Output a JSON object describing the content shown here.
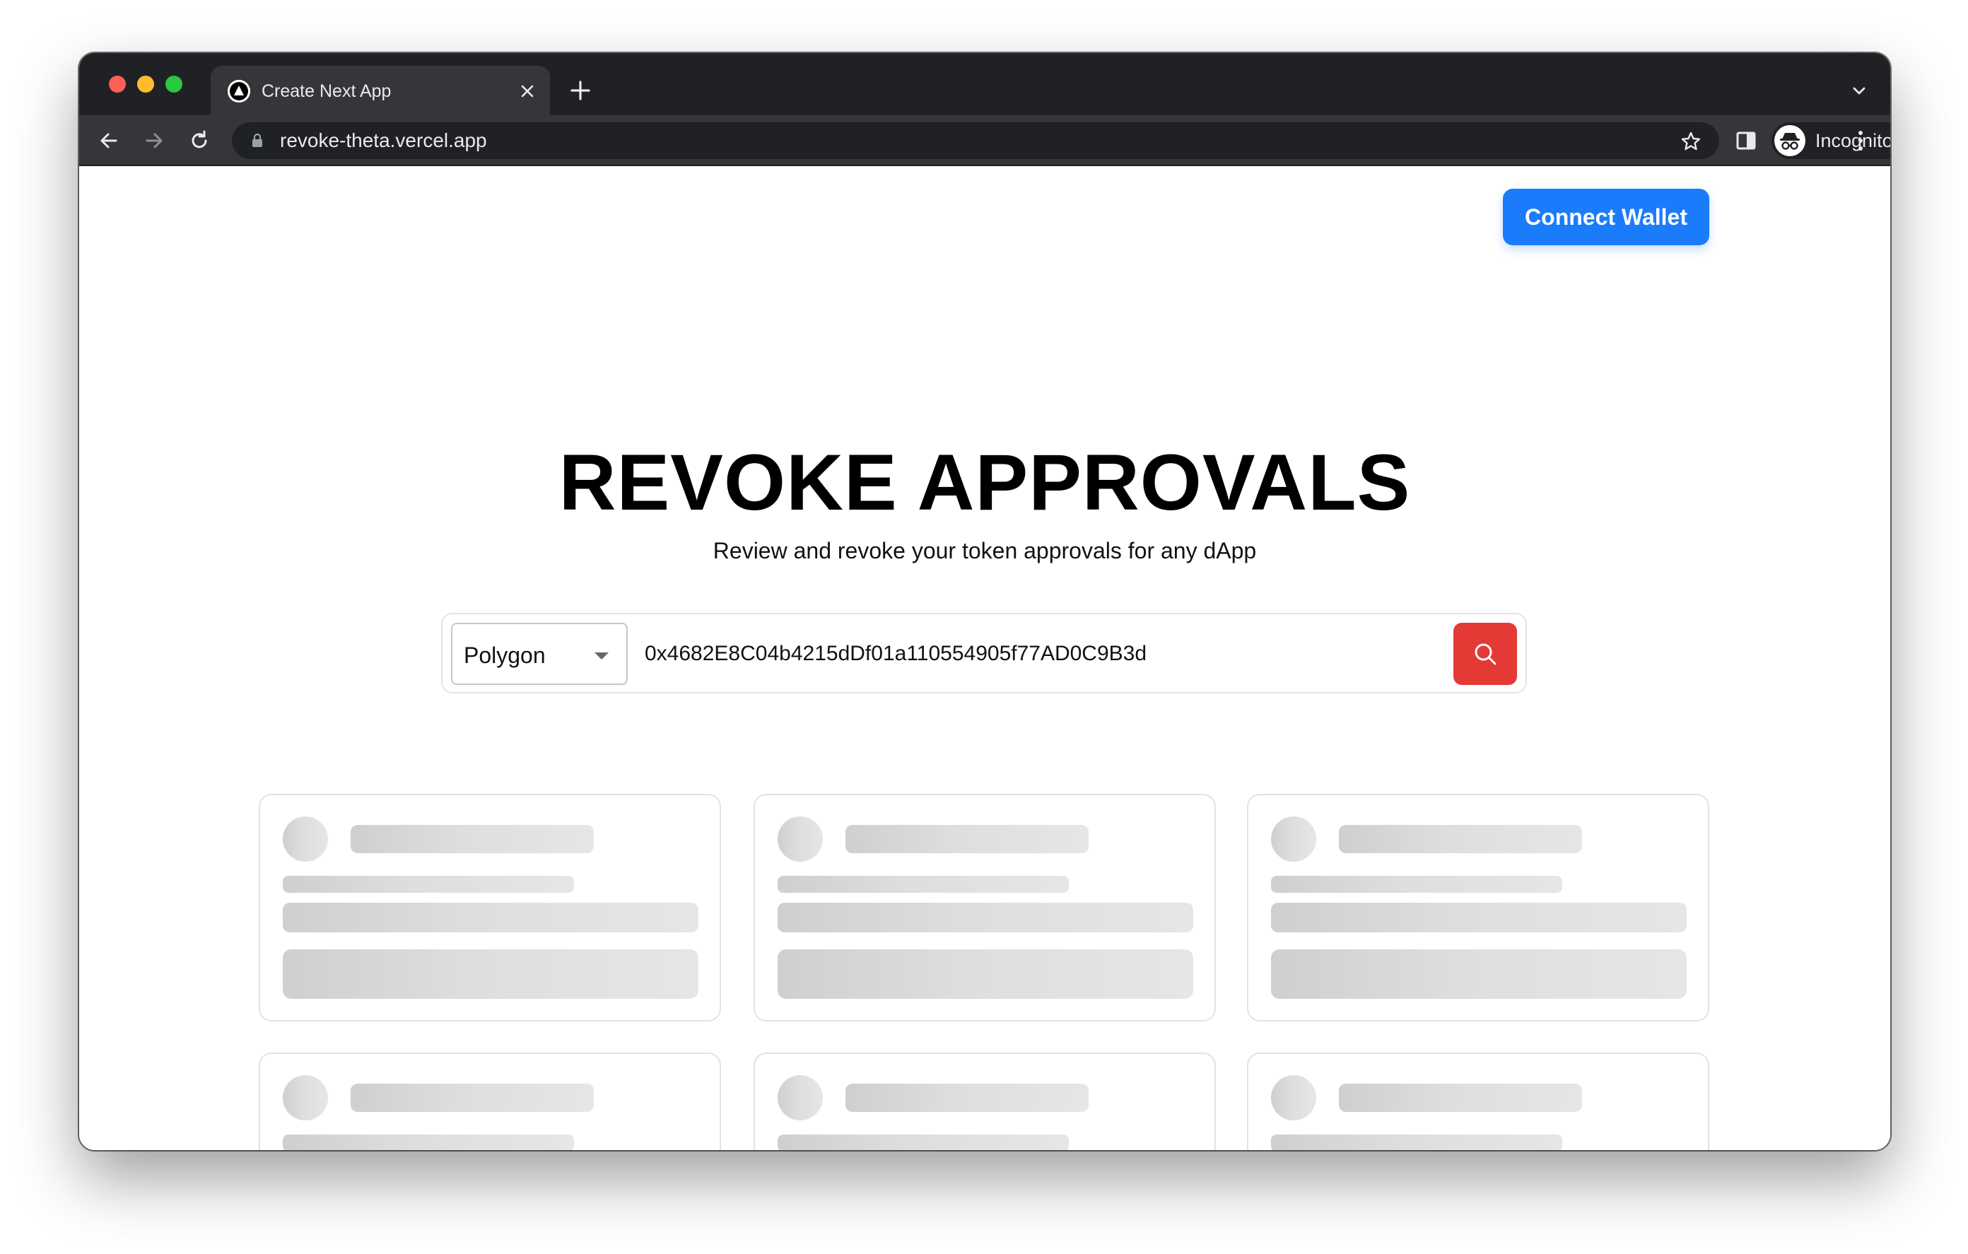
{
  "browser": {
    "tab_title": "Create Next App",
    "url": "revoke-theta.vercel.app",
    "incognito_label": "Incognito"
  },
  "header": {
    "connect_wallet_label": "Connect Wallet",
    "accent_color": "#1a7cfa"
  },
  "hero": {
    "title": "REVOKE APPROVALS",
    "subtitle": "Review and revoke your token approvals for any dApp"
  },
  "search": {
    "network_selected": "Polygon",
    "address_value": "0x4682E8C04b4215dDf01a110554905f77AD0C9B3d",
    "search_button_color": "#e53935",
    "search_icon": "search-icon"
  },
  "cards": {
    "state": "loading-skeleton"
  }
}
